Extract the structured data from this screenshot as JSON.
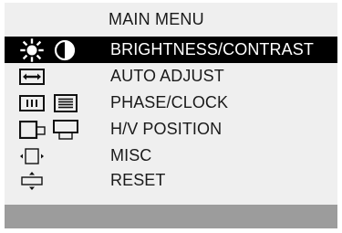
{
  "menu": {
    "title": "MAIN MENU",
    "items": [
      {
        "label": "BRIGHTNESS/CONTRAST",
        "selected": true
      },
      {
        "label": "AUTO ADJUST",
        "selected": false
      },
      {
        "label": "PHASE/CLOCK",
        "selected": false
      },
      {
        "label": "H/V POSITION",
        "selected": false
      },
      {
        "label": "MISC",
        "selected": false
      },
      {
        "label": "RESET",
        "selected": false
      }
    ]
  },
  "icons": {
    "brightness": "sun-icon",
    "contrast": "contrast-icon",
    "auto_adjust": "auto-adjust-icon",
    "phase": "phase-icon",
    "clock": "clock-icon",
    "h_position": "horizontal-position-icon",
    "v_position": "vertical-position-icon",
    "misc": "misc-icon",
    "reset": "reset-icon"
  },
  "colors": {
    "background": "#efefef",
    "selected_bg": "#000000",
    "selected_text": "#ffffff",
    "text": "#1a1a1a",
    "bottom_bar": "#9c9c9c"
  }
}
